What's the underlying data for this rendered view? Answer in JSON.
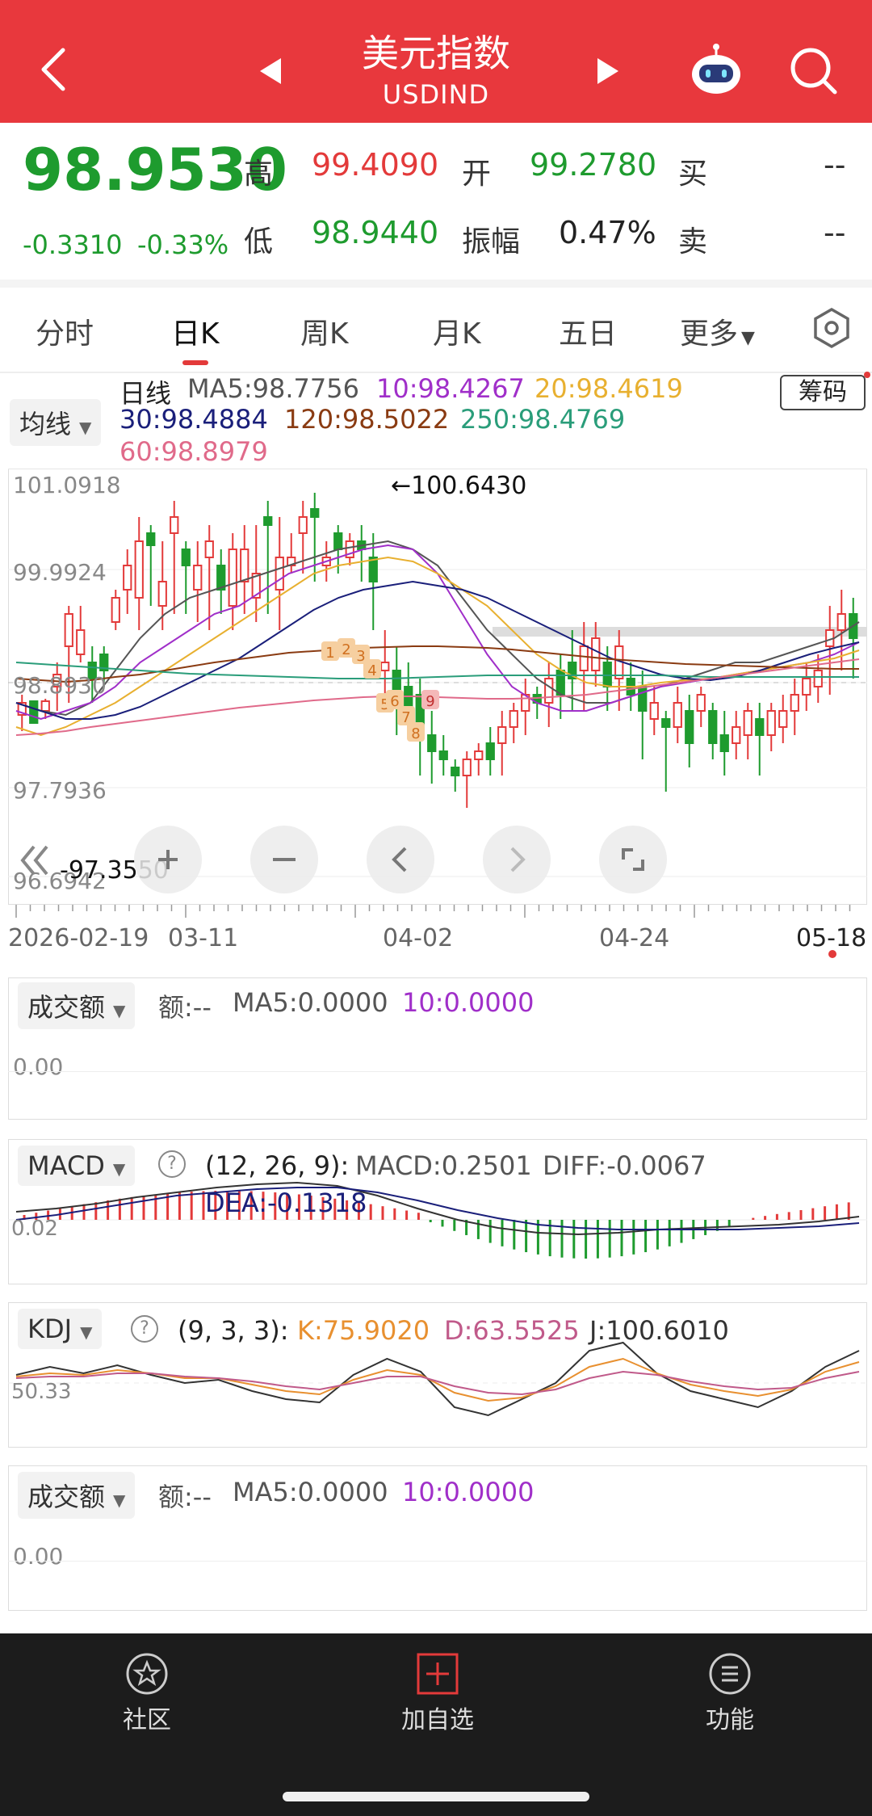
{
  "header": {
    "title": "美元指数",
    "subtitle": "USDIND"
  },
  "quote": {
    "price": "98.9530",
    "change": "-0.3310",
    "change_pct": "-0.33%",
    "high_label": "高",
    "high": "99.4090",
    "open_label": "开",
    "open": "99.2780",
    "buy_label": "买",
    "buy": "--",
    "low_label": "低",
    "low": "98.9440",
    "amp_label": "振幅",
    "amp": "0.47%",
    "sell_label": "卖",
    "sell": "--"
  },
  "tabs": [
    "分时",
    "日K",
    "周K",
    "月K",
    "五日",
    "更多"
  ],
  "main_chart": {
    "ma_selector": "均线",
    "chips_button": "筹码",
    "period": "日线",
    "ma": {
      "ma5": "MA5:98.7756",
      "ma10": "10:98.4267",
      "ma20": "20:98.4619",
      "ma30": "30:98.4884",
      "ma120": "120:98.5022",
      "ma250": "250:98.4769",
      "ma60": "60:98.8979"
    },
    "y_ticks": [
      "101.0918",
      "99.9924",
      "98.8930",
      "97.7936",
      "96.6942"
    ],
    "max_annot": "←100.6430",
    "min_annot": "-97.3550",
    "x_ticks": [
      "2026-02-19",
      "03-11",
      "04-02",
      "04-24",
      "05-18"
    ],
    "td_labels": [
      "1",
      "2",
      "3",
      "4",
      "5",
      "6",
      "7",
      "8",
      "9"
    ]
  },
  "colors": {
    "header_bg": "#e8383d",
    "up": "#e33a3a",
    "down": "#1e9b2e",
    "ma5": "#555555",
    "ma10": "#a02fc9",
    "ma20": "#e8b030",
    "ma30": "#1a1f7a",
    "ma60": "#e06a8a",
    "ma120": "#8a3b12",
    "ma250": "#2a9d7a"
  },
  "volume1": {
    "selector": "成交额",
    "amount": "额:--",
    "ma5": "MA5:0.0000",
    "ma10": "10:0.0000",
    "zero": "0.00"
  },
  "macd": {
    "selector": "MACD",
    "help": "?",
    "params": "(12, 26, 9):",
    "macd": "MACD:0.2501",
    "diff": "DIFF:-0.0067",
    "dea": "DEA:-0.1318",
    "tick": "0.02"
  },
  "kdj": {
    "selector": "KDJ",
    "help": "?",
    "params": "(9, 3, 3):",
    "k": "K:75.9020",
    "d": "D:63.5525",
    "j": "J:100.6010",
    "tick": "50.33"
  },
  "volume2": {
    "selector": "成交额",
    "amount": "额:--",
    "ma5": "MA5:0.0000",
    "ma10": "10:0.0000",
    "zero": "0.00"
  },
  "bottom_nav": [
    {
      "label": "社区",
      "icon": "community-icon"
    },
    {
      "label": "加自选",
      "icon": "add-watchlist-icon"
    },
    {
      "label": "功能",
      "icon": "menu-icon"
    }
  ]
}
